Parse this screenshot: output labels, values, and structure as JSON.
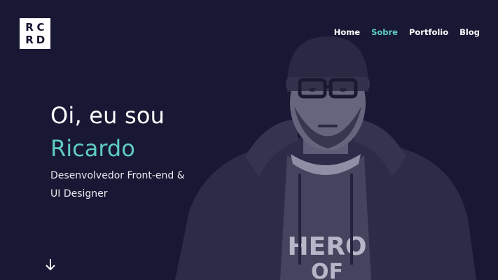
{
  "logo": {
    "letters": [
      "R",
      "C",
      "R",
      "D"
    ]
  },
  "nav": {
    "items": [
      {
        "label": "Home",
        "active": false
      },
      {
        "label": "Sobre",
        "active": true
      },
      {
        "label": "Portfolio",
        "active": false
      },
      {
        "label": "Blog",
        "active": false
      }
    ]
  },
  "hero": {
    "greeting": "Oi, eu sou",
    "name": "Ricardo",
    "subtitle_line1": "Desenvolvedor Front-end &",
    "subtitle_line2": "UI Designer",
    "shirt_text_line1": "HERO",
    "shirt_text_line2": "OF"
  },
  "colors": {
    "background": "#191834",
    "accent": "#5fcdc4",
    "text": "#ffffff"
  },
  "icons": {
    "scroll": "arrow-down-icon"
  }
}
